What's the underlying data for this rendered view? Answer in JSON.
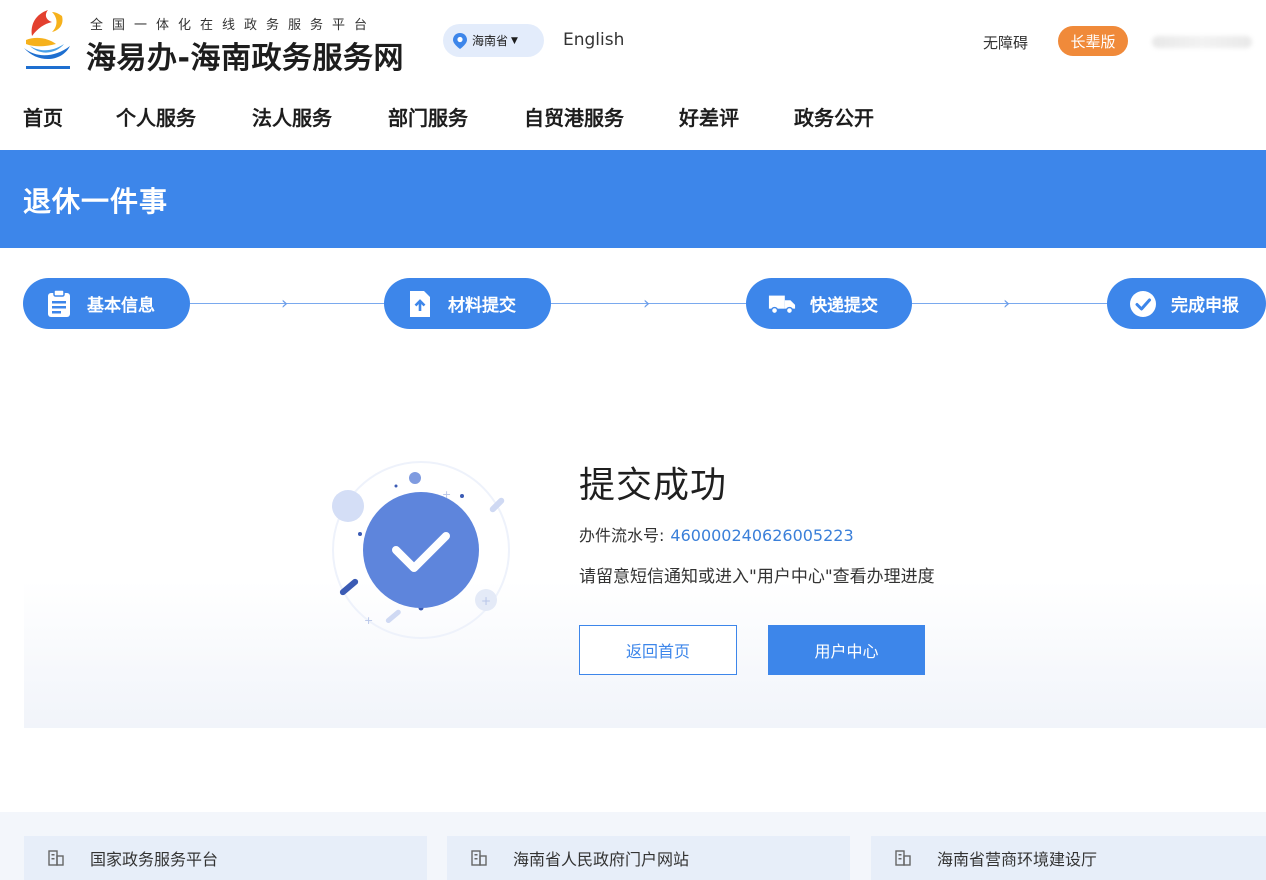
{
  "header": {
    "subtitle": "全国一体化在线政务服务平台",
    "title": "海易办-海南政务服务网",
    "region": "海南省",
    "english": "English",
    "accessibility": "无障碍",
    "elder_mode": "长辈版"
  },
  "nav": {
    "items": [
      {
        "label": "首页"
      },
      {
        "label": "个人服务"
      },
      {
        "label": "法人服务"
      },
      {
        "label": "部门服务"
      },
      {
        "label": "自贸港服务"
      },
      {
        "label": "好差评"
      },
      {
        "label": "政务公开"
      }
    ]
  },
  "banner": {
    "title": "退休一件事"
  },
  "steps": [
    {
      "label": "基本信息",
      "icon": "clipboard-icon"
    },
    {
      "label": "材料提交",
      "icon": "upload-file-icon"
    },
    {
      "label": "快递提交",
      "icon": "delivery-truck-icon"
    },
    {
      "label": "完成申报",
      "icon": "check-circle-icon"
    }
  ],
  "result": {
    "title": "提交成功",
    "serial_label": "办件流水号:",
    "serial_number": "460000240626005223",
    "notice": "请留意短信通知或进入\"用户中心\"查看办理进度",
    "home_button": "返回首页",
    "user_center_button": "用户中心"
  },
  "footer": {
    "links": [
      {
        "label": "国家政务服务平台",
        "icon": "building-icon"
      },
      {
        "label": "海南省人民政府门户网站",
        "icon": "building-icon"
      },
      {
        "label": "海南省营商环境建设厅",
        "icon": "building-icon"
      }
    ]
  },
  "colors": {
    "primary": "#3d86ea",
    "accent_orange": "#f08a3a",
    "serial_link": "#3a7fd9"
  }
}
